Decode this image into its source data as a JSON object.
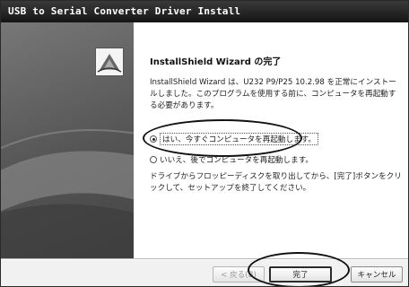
{
  "window": {
    "title": "USB to Serial Converter Driver Install"
  },
  "content": {
    "heading": "InstallShield Wizard の完了",
    "body_text": "InstallShield Wizard は、U232 P9/P25 10.2.98 を正常にインストールしました。このプログラムを使用する前に、コンピュータを再起動する必要があります。",
    "radio_yes": "はい、今すぐコンピュータを再起動します。",
    "radio_no": "いいえ、後でコンピュータを再起動します。",
    "hint_text": "ドライブからフロッピーディスクを取り出してから、[完了]ボタンをクリックして、セットアップを終了してください。"
  },
  "buttons": {
    "back": "< 戻る(B)",
    "finish": "完了",
    "cancel": "キャンセル"
  },
  "radio": {
    "selected": "yes"
  }
}
